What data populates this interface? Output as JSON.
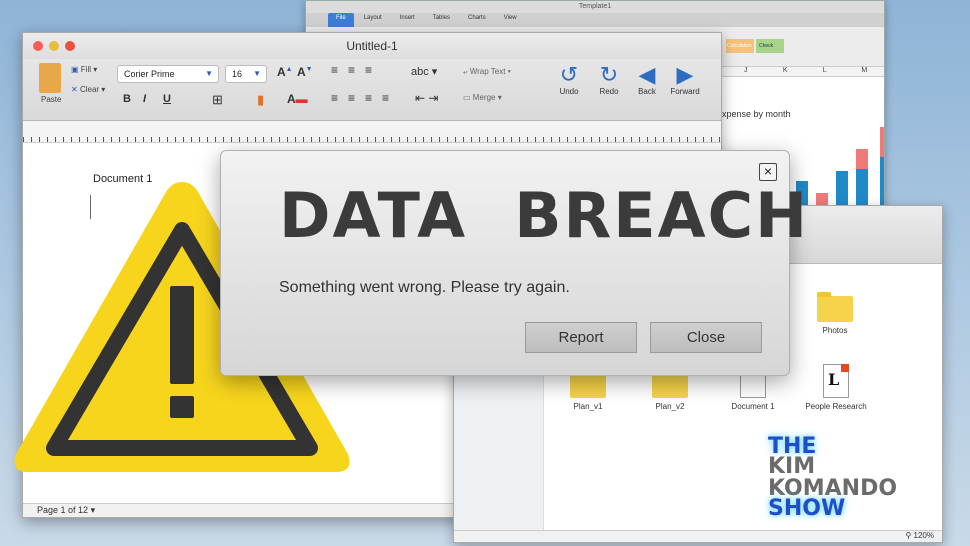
{
  "spreadsheet": {
    "window_title": "Template1",
    "tabs": [
      "File",
      "Layout",
      "Insert",
      "Tables",
      "Charts",
      "View"
    ],
    "active_tab": "File",
    "column_headers": [
      "J",
      "K",
      "L",
      "M"
    ],
    "chart_title": "Expense by month",
    "ribbon_style_labels": [
      "Calculation",
      "Check"
    ],
    "colors": {
      "bar_blue": "#1f8ac8",
      "bar_red": "#ef7a7a"
    }
  },
  "word": {
    "window_title": "Untitled-1",
    "paste_label": "Paste",
    "fill_label": "Fill",
    "clear_label": "Clear",
    "font_name": "Corier Prime",
    "font_size": "16",
    "bold": "B",
    "italic": "I",
    "underline": "U",
    "spell_label": "abc",
    "wrap_text_label": "Wrap Text",
    "merge_label": "Merge",
    "undo_label": "Undo",
    "redo_label": "Redo",
    "back_label": "Back",
    "forward_label": "Forward",
    "document_text": "Document 1",
    "status": "Page 1 of 12"
  },
  "finder": {
    "items": [
      {
        "label": "Photos",
        "kind": "folder"
      },
      {
        "label": "Plan_v1",
        "kind": "folder"
      },
      {
        "label": "Plan_v2",
        "kind": "folder"
      },
      {
        "label": "Document 1",
        "kind": "document"
      },
      {
        "label": "People Research",
        "kind": "document-L"
      }
    ],
    "zoom": "120%"
  },
  "dialog": {
    "heading": "DATA  BREACH",
    "message": "Something went wrong. Please try again.",
    "report_label": "Report",
    "close_label": "Close",
    "close_icon": "×"
  },
  "warning": {
    "icon": "warning-triangle-icon",
    "fill": "#f7d51d",
    "stroke": "#333333"
  },
  "logo": {
    "line1": "THE",
    "line2": "KIM",
    "line3": "KOMANDO",
    "line4": "SHOW"
  }
}
